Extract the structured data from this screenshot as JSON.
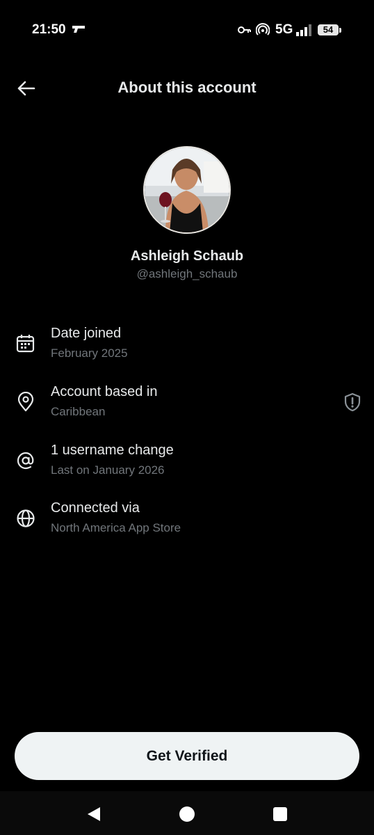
{
  "status_bar": {
    "time": "21:50",
    "network": "5G",
    "battery": "54",
    "icons": [
      "gun-icon",
      "vpn-key-icon",
      "hotspot-icon",
      "signal-icon",
      "battery-icon"
    ]
  },
  "header": {
    "title": "About this account",
    "back_icon": "back-arrow-icon"
  },
  "profile": {
    "name": "Ashleigh Schaub",
    "handle": "@ashleigh_schaub"
  },
  "info_items": [
    {
      "icon": "calendar-icon",
      "title": "Date joined",
      "subtitle": "February 2025"
    },
    {
      "icon": "location-pin-icon",
      "title": "Account based in",
      "subtitle": "Caribbean",
      "trailing_icon": "shield-alert-icon"
    },
    {
      "icon": "at-sign-icon",
      "title": "1 username change",
      "subtitle": "Last on January 2026"
    },
    {
      "icon": "globe-icon",
      "title": "Connected via",
      "subtitle": "North America App Store"
    }
  ],
  "cta": {
    "label": "Get Verified"
  },
  "nav": {
    "icons": [
      "nav-back-icon",
      "nav-home-icon",
      "nav-recents-icon"
    ]
  },
  "colors": {
    "background": "#000000",
    "primary_text": "#e7e9ea",
    "secondary_text": "#71767b",
    "button_bg": "#eff3f4",
    "button_text": "#0f1419"
  }
}
